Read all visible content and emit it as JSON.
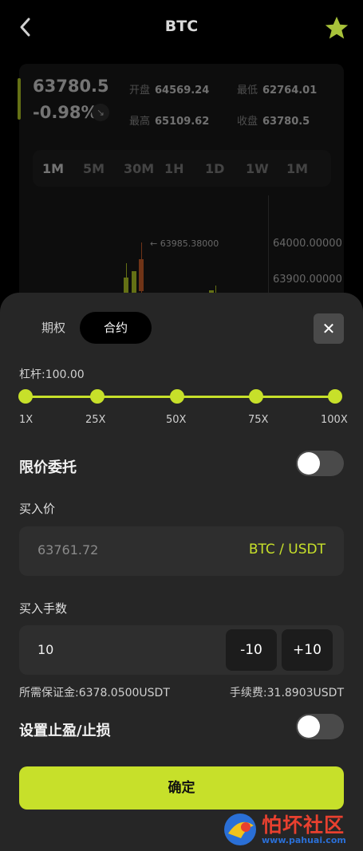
{
  "header": {
    "title": "BTC"
  },
  "ticker": {
    "price": "63780.5",
    "change": "-0.98%",
    "stats": [
      {
        "label": "开盘",
        "value": "64569.24"
      },
      {
        "label": "最低",
        "value": "62764.01"
      },
      {
        "label": "最高",
        "value": "65109.62"
      },
      {
        "label": "收盘",
        "value": "63780.5"
      }
    ]
  },
  "periods": [
    "1M",
    "5M",
    "30M",
    "1H",
    "1D",
    "1W",
    "1M"
  ],
  "chart": {
    "peak_label": "63985.38000",
    "y_labels": [
      "64000.00000",
      "63900.00000"
    ]
  },
  "tabs": [
    "期权",
    "合约"
  ],
  "leverage": {
    "label": "杠杆:100.00",
    "ticks": [
      "1X",
      "25X",
      "50X",
      "75X",
      "100X"
    ],
    "value_percent": 100
  },
  "limit_order": {
    "label": "限价委托",
    "enabled": false
  },
  "buy_price": {
    "label": "买入价",
    "value": "63761.72",
    "unit": "BTC / USDT"
  },
  "buy_qty": {
    "label": "买入手数",
    "value": "10",
    "minus": "-10",
    "plus": "+10"
  },
  "margin": "所需保证金:6378.0500USDT",
  "fee": "手续费:31.8903USDT",
  "stop": {
    "label": "设置止盈/止损",
    "enabled": false
  },
  "confirm_label": "确定",
  "watermark": {
    "title": "怕坏社区",
    "url": "www.pahuai.com"
  },
  "colors": {
    "accent": "#c7e02a",
    "sheet": "#262626",
    "star": "#a8c23a"
  }
}
